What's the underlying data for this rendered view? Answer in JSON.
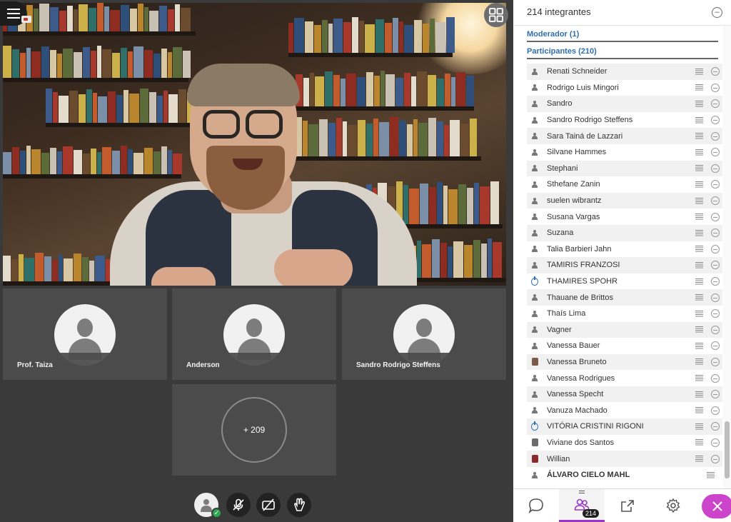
{
  "stage": {
    "menu_icon": "hamburger-menu-icon",
    "layout_icon": "grid-layout-icon",
    "tiles": [
      {
        "name": "Prof. Taiza"
      },
      {
        "name": "Anderson"
      },
      {
        "name": "Sandro Rodrigo Steffens"
      }
    ],
    "more_count": "+ 209"
  },
  "controls": {
    "self_status_icon": "checkmark-icon",
    "mic_icon": "microphone-off-icon",
    "camera_icon": "camera-off-icon",
    "hand_icon": "raise-hand-icon"
  },
  "panel": {
    "title": "214 integrantes",
    "collapse_icon": "minus-circle-icon",
    "moderators_label": "Moderador (1)",
    "participants_label": "Participantes (210)",
    "participants": [
      {
        "name": "Renati Schneider",
        "avatar": "person"
      },
      {
        "name": "Rodrigo Luis Mingori",
        "avatar": "person"
      },
      {
        "name": "Sandro",
        "avatar": "person"
      },
      {
        "name": "Sandro Rodrigo Steffens",
        "avatar": "person"
      },
      {
        "name": "Sara Tainá de Lazzari",
        "avatar": "person"
      },
      {
        "name": "Silvane Hammes",
        "avatar": "person"
      },
      {
        "name": "Stephani",
        "avatar": "person"
      },
      {
        "name": "Sthefane Zanin",
        "avatar": "person"
      },
      {
        "name": "suelen wibrantz",
        "avatar": "person"
      },
      {
        "name": "Susana Vargas",
        "avatar": "person"
      },
      {
        "name": "Suzana",
        "avatar": "person"
      },
      {
        "name": "Talia Barbieri Jahn",
        "avatar": "person"
      },
      {
        "name": "TAMIRIS FRANZOSI",
        "avatar": "person"
      },
      {
        "name": "THAMIRES SPOHR",
        "avatar": "ring"
      },
      {
        "name": "Thauane de Brittos",
        "avatar": "person"
      },
      {
        "name": "Thaís Lima",
        "avatar": "person"
      },
      {
        "name": "Vagner",
        "avatar": "person"
      },
      {
        "name": "Vanessa Bauer",
        "avatar": "person"
      },
      {
        "name": "Vanessa Bruneto",
        "avatar": "photo-brown"
      },
      {
        "name": "Vanessa Rodrigues",
        "avatar": "person"
      },
      {
        "name": "Vanessa Specht",
        "avatar": "person"
      },
      {
        "name": "Vanuza Machado",
        "avatar": "person"
      },
      {
        "name": "VITÓRIA CRISTINI RIGONI",
        "avatar": "ring"
      },
      {
        "name": "Viviane dos Santos",
        "avatar": "photo-gray"
      },
      {
        "name": "Willian",
        "avatar": "photo-red"
      },
      {
        "name": "ÁLVARO CIELO MAHL",
        "avatar": "person"
      }
    ]
  },
  "bottom_bar": {
    "chat_icon": "chat-bubble-icon",
    "people_icon": "people-icon",
    "people_count": "214",
    "share_icon": "share-icon",
    "settings_icon": "gear-icon",
    "close_icon": "close-icon"
  },
  "colors": {
    "accent": "#2e6fb0",
    "purple": "#9b35c7",
    "close": "#cc44cc",
    "stage_bg": "#3a3a3a"
  }
}
